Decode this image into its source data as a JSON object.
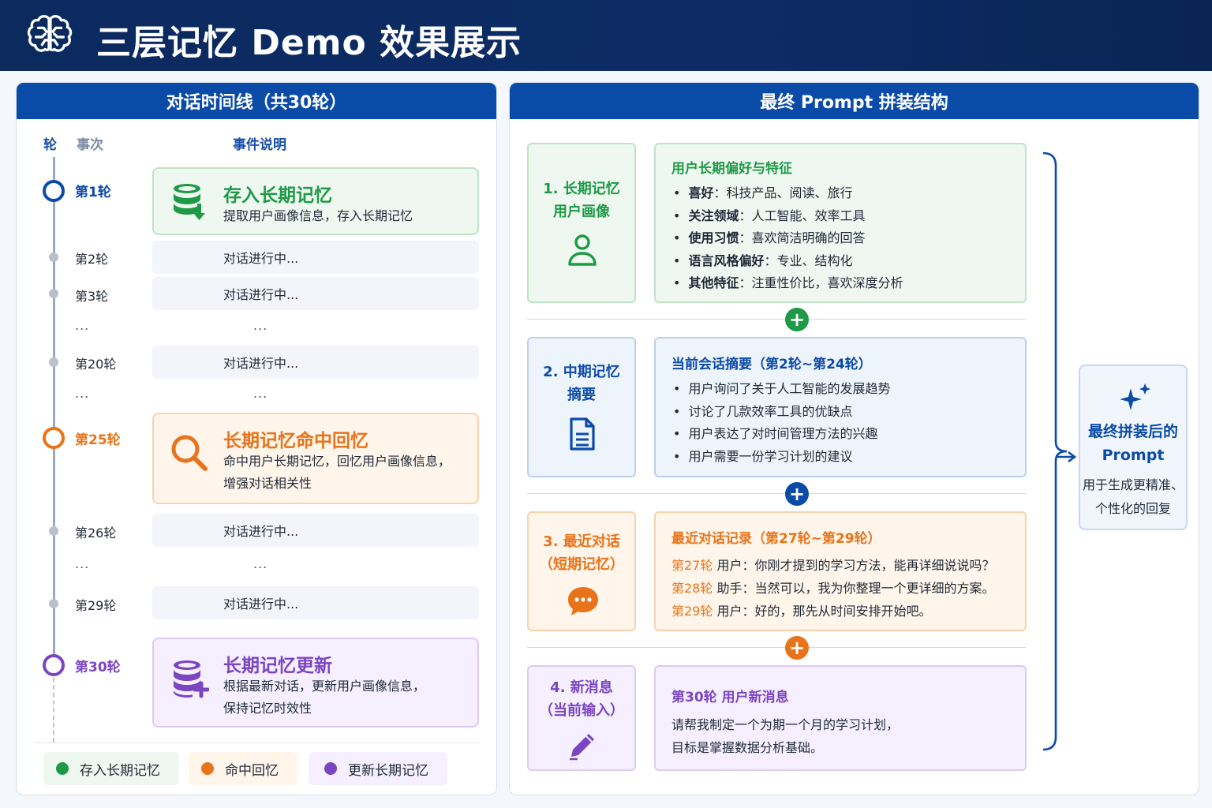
{
  "title": "三层记忆 Demo 效果展示",
  "left_panel": {
    "title": "对话时间线（共30轮）",
    "columns": {
      "round": "轮",
      "turn": "事次",
      "event": "事件说明"
    },
    "timeline": {
      "r1": {
        "label": "第1轮",
        "title": "存入长期记忆",
        "desc1": "提取用户画像信息，存入长期记忆"
      },
      "r2": {
        "label": "第2轮",
        "text": "对话进行中..."
      },
      "r3": {
        "label": "第3轮",
        "text": "对话进行中..."
      },
      "ellipsis": "...",
      "r20": {
        "label": "第20轮",
        "text": "对话进行中..."
      },
      "r25": {
        "label": "第25轮",
        "title": "长期记忆命中回忆",
        "desc1": "命中用户长期记忆，回忆用户画像信息，",
        "desc2": "增强对话相关性"
      },
      "r26": {
        "label": "第26轮",
        "text": "对话进行中..."
      },
      "r29": {
        "label": "第29轮",
        "text": "对话进行中..."
      },
      "r30": {
        "label": "第30轮",
        "title": "长期记忆更新",
        "desc1": "根据最新对话，更新用户画像信息，",
        "desc2": "保持记忆时效性"
      }
    },
    "legend": [
      "存入长期记忆",
      "命中回忆",
      "更新长期记忆"
    ]
  },
  "right_panel": {
    "title": "最终 Prompt 拼装结构",
    "sections": [
      {
        "cat1": "1. 长期记忆",
        "cat2": "用户画像",
        "icon": "user-icon",
        "heading": "用户长期偏好与特征",
        "items": [
          {
            "k": "喜好",
            "v": "：科技产品、阅读、旅行"
          },
          {
            "k": "关注领域",
            "v": "：人工智能、效率工具"
          },
          {
            "k": "使用习惯",
            "v": "：喜欢简洁明确的回答"
          },
          {
            "k": "语言风格偏好",
            "v": "：专业、结构化"
          },
          {
            "k": "其他特征",
            "v": "：注重性价比，喜欢深度分析"
          }
        ]
      },
      {
        "cat1": "2. 中期记忆",
        "cat2": "摘要",
        "icon": "document-icon",
        "heading": "当前会话摘要（第2轮~第24轮）",
        "items": [
          "用户询问了关于人工智能的发展趋势",
          "讨论了几款效率工具的优缺点",
          "用户表达了对时间管理方法的兴趣",
          "用户需要一份学习计划的建议"
        ]
      },
      {
        "cat1": "3. 最近对话",
        "cat2": "（短期记忆）",
        "icon": "chat-icon",
        "heading": "最近对话记录（第27轮~第29轮）",
        "items": [
          {
            "r": "第27轮",
            "t": " 用户：你刚才提到的学习方法，能再详细说说吗？"
          },
          {
            "r": "第28轮",
            "t": " 助手：当然可以，我为你整理一个更详细的方案。"
          },
          {
            "r": "第29轮",
            "t": " 用户：好的，那先从时间安排开始吧。"
          }
        ]
      },
      {
        "cat1": "4. 新消息",
        "cat2": "（当前输入）",
        "icon": "pencil-icon",
        "heading": "第30轮 用户新消息",
        "items": [
          "请帮我制定一个为期一个月的学习计划，",
          "目标是掌握数据分析基础。"
        ]
      }
    ],
    "plus": "+",
    "final": {
      "title1": "最终拼装后的",
      "title2": "Prompt",
      "desc1": "用于生成更精准、",
      "desc2": "个性化的回复"
    }
  },
  "colors": {
    "blue": "#0b4ba8",
    "green": "#1e9a47",
    "orange": "#e8731a",
    "purple": "#7b45c2",
    "navy": "#0b2a5e"
  }
}
